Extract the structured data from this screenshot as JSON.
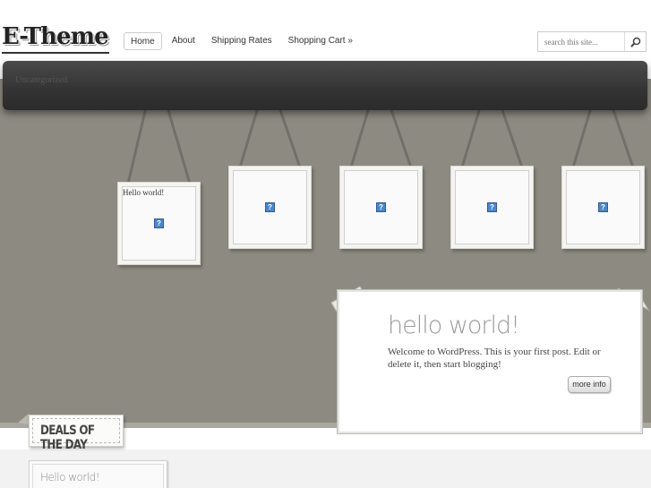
{
  "header": {
    "logo_text": "E-Theme",
    "nav": [
      {
        "label": "Home",
        "active": true
      },
      {
        "label": "About"
      },
      {
        "label": "Shipping Rates"
      },
      {
        "label": "Shopping Cart »"
      }
    ],
    "search": {
      "placeholder": "search this site..."
    }
  },
  "category_bar": {
    "label": "Uncategorized"
  },
  "frames": [
    {
      "caption": "Hello world!"
    },
    {
      "caption": ""
    },
    {
      "caption": ""
    },
    {
      "caption": ""
    },
    {
      "caption": ""
    }
  ],
  "featured": {
    "title": "hello world!",
    "body": "Welcome to WordPress. This is your first post. Edit or delete it, then start blogging!",
    "button": "more info"
  },
  "deals": {
    "label": "DEALS OF THE DAY"
  },
  "deal_item": {
    "title": "Hello world!"
  },
  "colors": {
    "stage": "#8d8b81",
    "bar": "#3a3a3a",
    "thumb": "#4f86c6"
  }
}
